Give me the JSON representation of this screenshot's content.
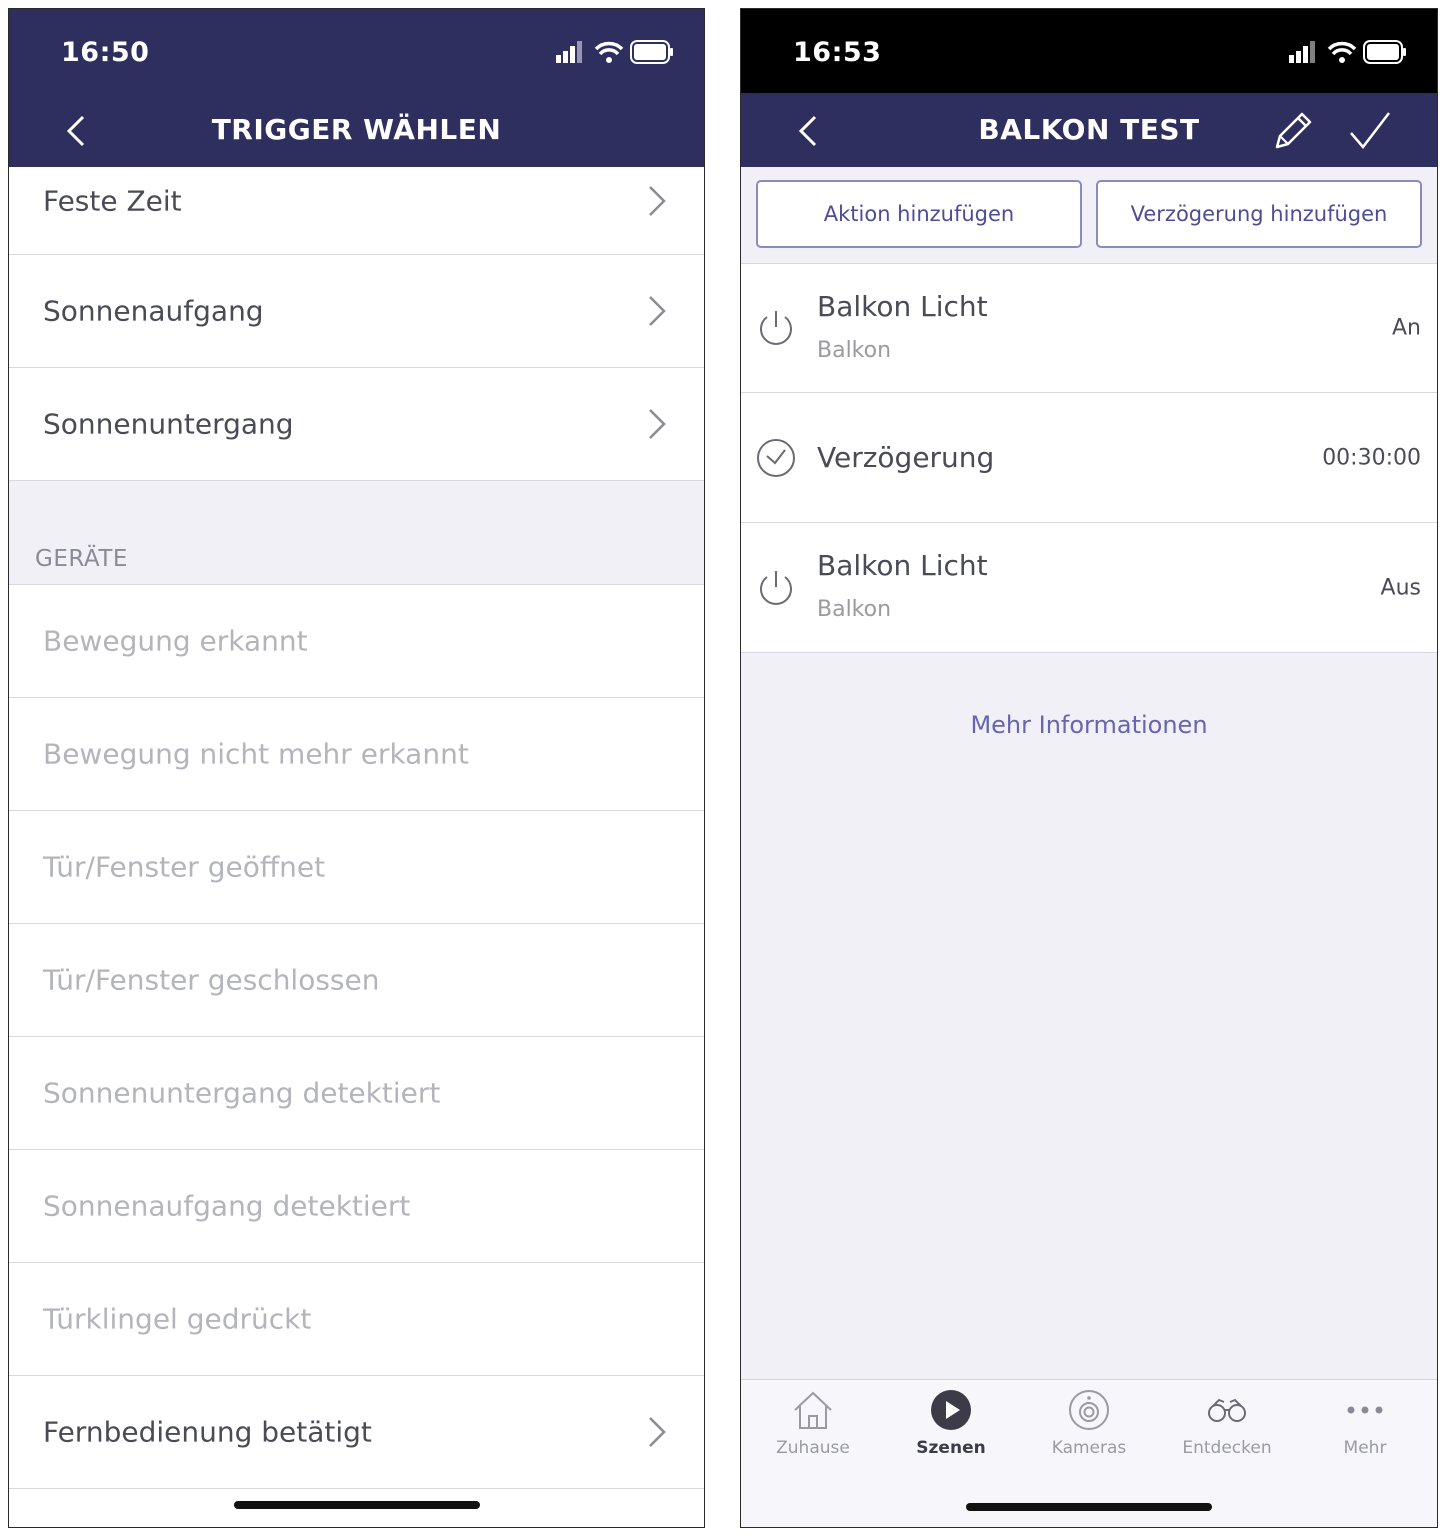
{
  "left": {
    "status_time": "16:50",
    "title": "TRIGGER WÄHLEN",
    "items": [
      {
        "label": "Feste Zeit"
      },
      {
        "label": "Sonnenaufgang"
      },
      {
        "label": "Sonnenuntergang"
      }
    ],
    "section_title": "GERÄTE",
    "device_items": [
      {
        "label": "Bewegung erkannt"
      },
      {
        "label": "Bewegung nicht mehr erkannt"
      },
      {
        "label": "Tür/Fenster geöffnet"
      },
      {
        "label": "Tür/Fenster geschlossen"
      },
      {
        "label": "Sonnenuntergang detektiert"
      },
      {
        "label": "Sonnenaufgang detektiert"
      },
      {
        "label": "Türklingel gedrückt"
      },
      {
        "label": "Fernbedienung betätigt"
      }
    ]
  },
  "right": {
    "status_time": "16:53",
    "title": "BALKON TEST",
    "add_action_label": "Aktion hinzufügen",
    "add_delay_label": "Verzögerung hinzufügen",
    "steps": [
      {
        "name": "Balkon Licht",
        "room": "Balkon",
        "value": "An"
      },
      {
        "name": "Verzögerung",
        "value": "00:30:00"
      },
      {
        "name": "Balkon Licht",
        "room": "Balkon",
        "value": "Aus"
      }
    ],
    "more_info_label": "Mehr Informationen",
    "tabs": [
      {
        "label": "Zuhause"
      },
      {
        "label": "Szenen"
      },
      {
        "label": "Kameras"
      },
      {
        "label": "Entdecken"
      },
      {
        "label": "Mehr"
      }
    ]
  },
  "colors": {
    "navbar": "#2e2e5f",
    "accent": "#6665b0",
    "background": "#f1f0f7"
  }
}
